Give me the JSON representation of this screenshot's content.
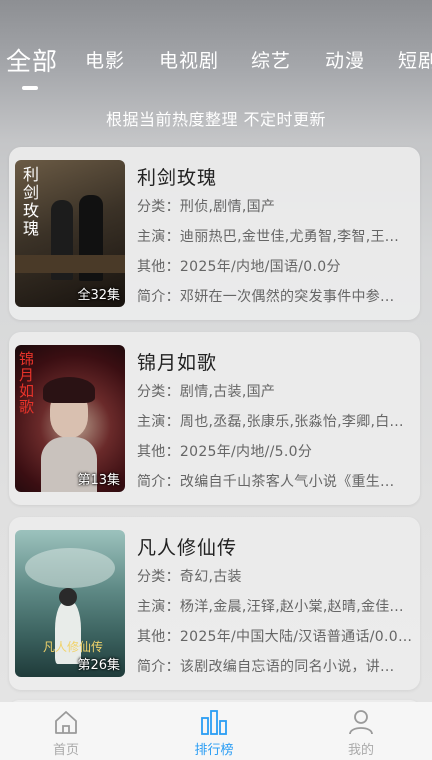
{
  "tabs": [
    {
      "label": "全部",
      "active": true
    },
    {
      "label": "电影",
      "active": false
    },
    {
      "label": "电视剧",
      "active": false
    },
    {
      "label": "综艺",
      "active": false
    },
    {
      "label": "动漫",
      "active": false
    },
    {
      "label": "短剧",
      "active": false
    }
  ],
  "notice": "根据当前热度整理 不定时更新",
  "items": [
    {
      "title": "利剑玫瑰",
      "category": "分类：刑侦,剧情,国产",
      "cast": "主演：迪丽热巴,金世佳,尤勇智,李智,王...",
      "other": "其他：2025年/内地/国语/0.0分",
      "summary": "简介：邓妍在一次偶然的突发事件中参...",
      "episodes": "全32集",
      "poster_text": "利剑玫瑰",
      "poster_colors": [
        "#3b3227",
        "#17120e"
      ]
    },
    {
      "title": "锦月如歌",
      "category": "分类：剧情,古装,国产",
      "cast": "主演：周也,丞磊,张康乐,张淼怡,李卿,白...",
      "other": "其他：2025年/内地//5.0分",
      "summary": "简介：改编自千山茶客人气小说《重生...",
      "episodes": "第13集",
      "poster_text": "锦月如歌",
      "poster_colors": [
        "#5a1518",
        "#1a0a0c"
      ]
    },
    {
      "title": "凡人修仙传",
      "category": "分类：奇幻,古装",
      "cast": "主演：杨洋,金晨,汪铎,赵小棠,赵晴,金佳...",
      "other": "其他：2025年/中国大陆/汉语普通话/0.0...",
      "summary": "简介：该剧改编自忘语的同名小说，讲...",
      "episodes": "第26集",
      "poster_text": "凡人修仙传",
      "poster_colors": [
        "#5f8a86",
        "#1f3b3a"
      ]
    }
  ],
  "nav": [
    {
      "label": "首页",
      "icon": "home-icon",
      "active": false
    },
    {
      "label": "排行榜",
      "icon": "ranking-icon",
      "active": true
    },
    {
      "label": "我的",
      "icon": "user-icon",
      "active": false
    }
  ],
  "colors": {
    "accent": "#2a9df4",
    "inactive": "#aaaaaa"
  }
}
